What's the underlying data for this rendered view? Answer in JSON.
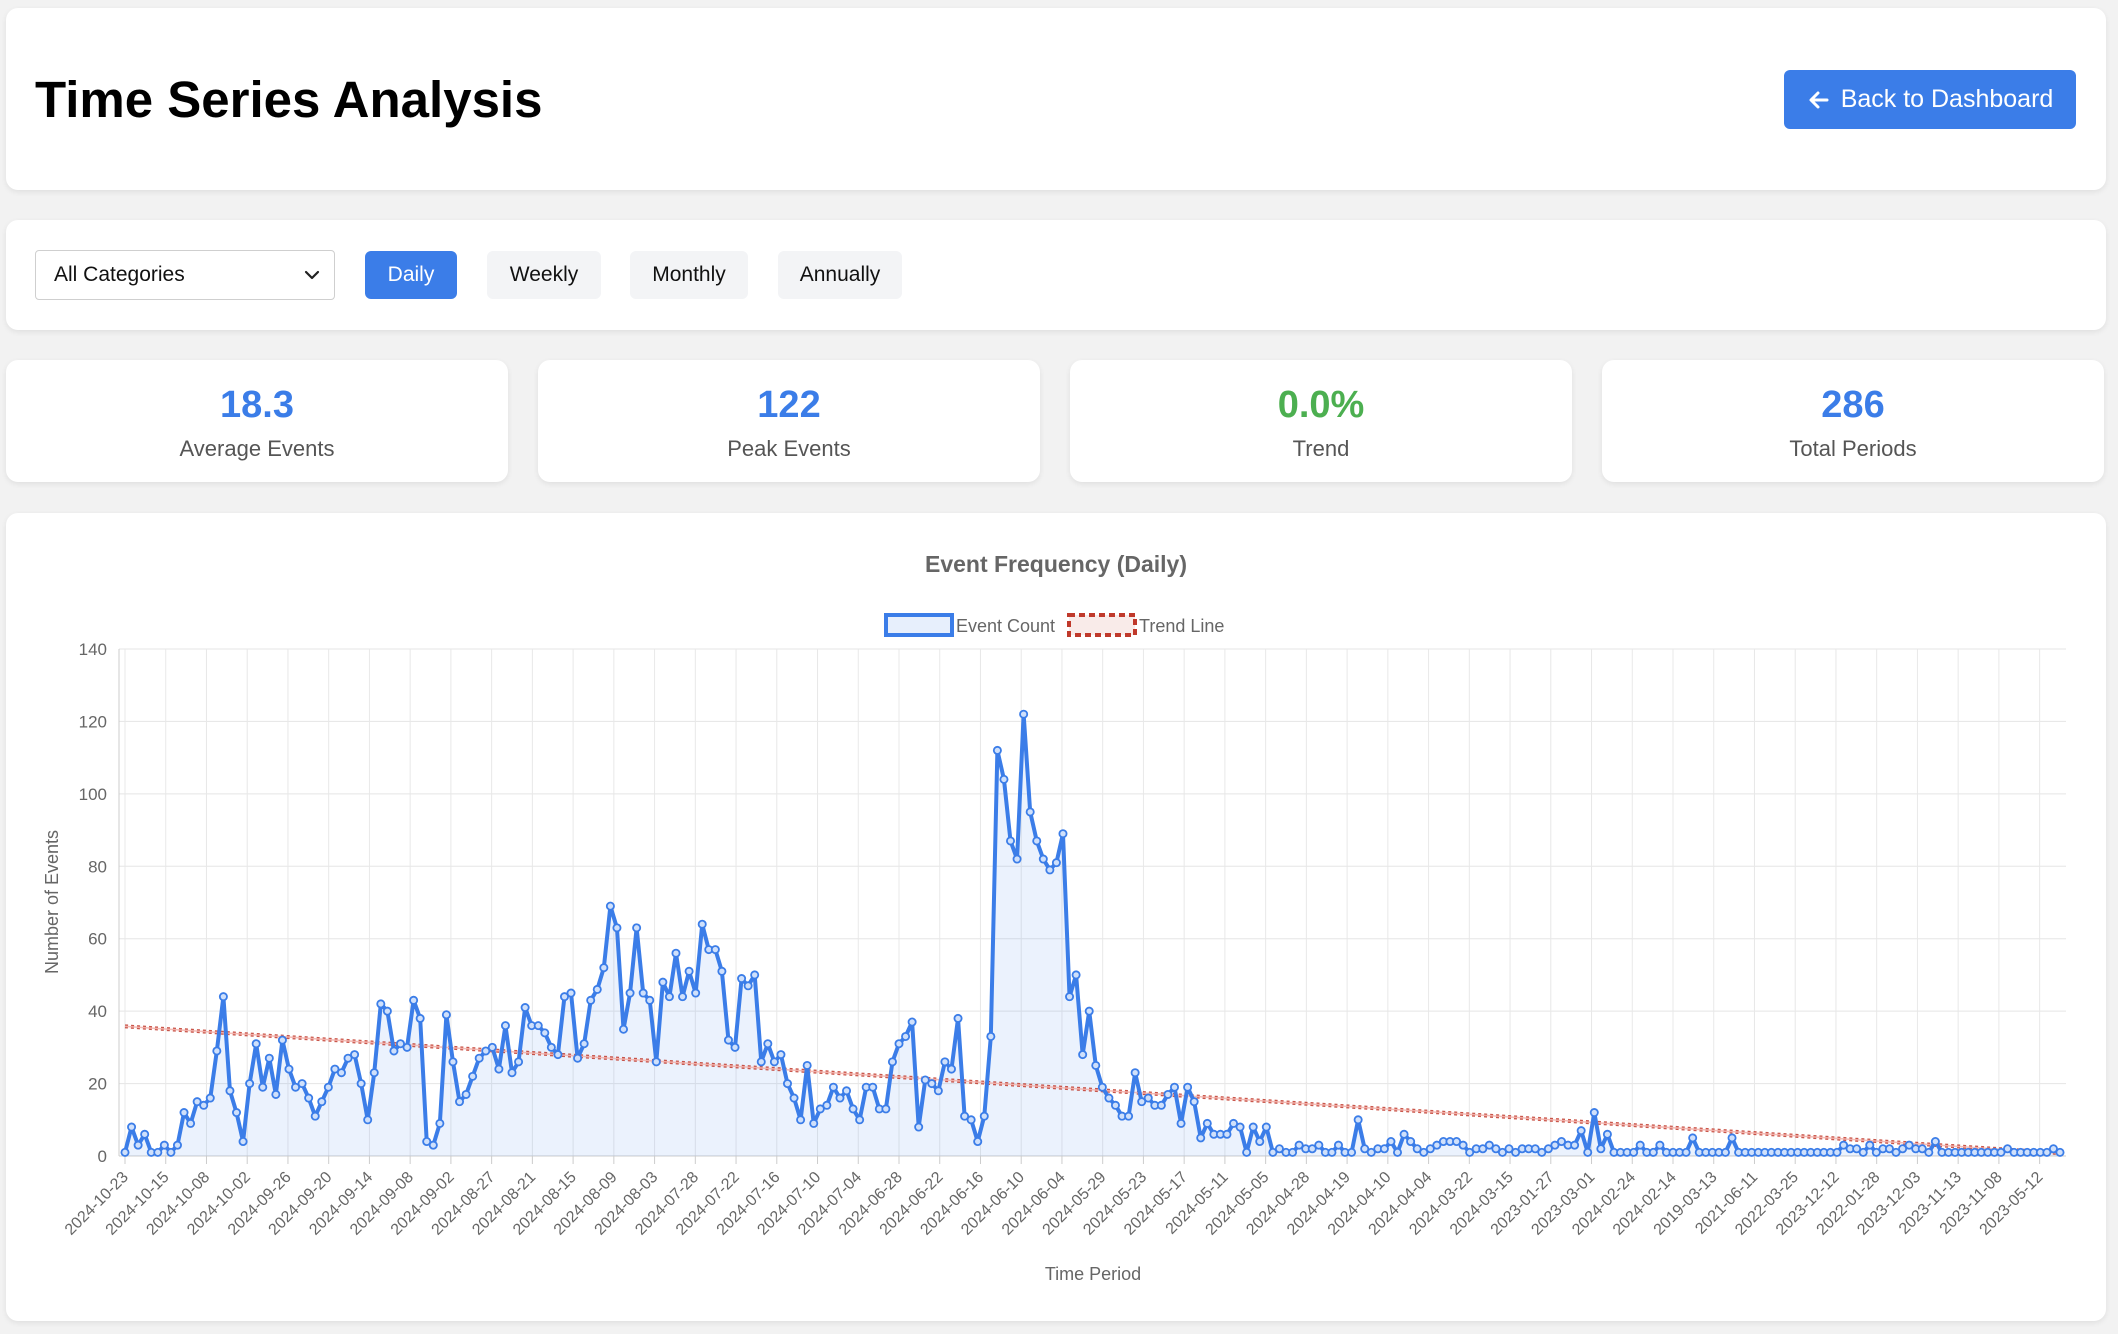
{
  "header": {
    "title": "Time Series Analysis",
    "back_label": "Back to Dashboard"
  },
  "controls": {
    "category": "All Categories",
    "periods": [
      {
        "label": "Daily",
        "active": true
      },
      {
        "label": "Weekly",
        "active": false
      },
      {
        "label": "Monthly",
        "active": false
      },
      {
        "label": "Annually",
        "active": false
      }
    ]
  },
  "stats": [
    {
      "value": "18.3",
      "label": "Average Events",
      "color": "#3b7de8"
    },
    {
      "value": "122",
      "label": "Peak Events",
      "color": "#3b7de8"
    },
    {
      "value": "0.0%",
      "label": "Trend",
      "color": "#4caf50"
    },
    {
      "value": "286",
      "label": "Total Periods",
      "color": "#3b7de8"
    }
  ],
  "colors": {
    "accent": "#3b7de8",
    "trend": "#c0392b",
    "positive": "#4caf50"
  },
  "chart_data": {
    "type": "line",
    "title": "Event Frequency (Daily)",
    "xlabel": "Time Period",
    "ylabel": "Number of Events",
    "ylim": [
      0,
      140
    ],
    "yticks": [
      0,
      20,
      40,
      60,
      80,
      100,
      120,
      140
    ],
    "grid": true,
    "legend_position": "top-center",
    "x_tick_labels": [
      "2024-10-23",
      "2024-10-15",
      "2024-10-08",
      "2024-10-02",
      "2024-09-26",
      "2024-09-20",
      "2024-09-14",
      "2024-09-08",
      "2024-09-02",
      "2024-08-27",
      "2024-08-21",
      "2024-08-15",
      "2024-08-09",
      "2024-08-03",
      "2024-07-28",
      "2024-07-22",
      "2024-07-16",
      "2024-07-10",
      "2024-07-04",
      "2024-06-28",
      "2024-06-22",
      "2024-06-16",
      "2024-06-10",
      "2024-06-04",
      "2024-05-29",
      "2024-05-23",
      "2024-05-17",
      "2024-05-11",
      "2024-05-05",
      "2024-04-28",
      "2024-04-19",
      "2024-04-10",
      "2024-04-04",
      "2024-03-22",
      "2024-03-15",
      "2023-01-27",
      "2023-03-01",
      "2024-02-24",
      "2024-02-14",
      "2019-03-13",
      "2021-06-11",
      "2022-03-25",
      "2023-12-12",
      "2022-01-28",
      "2023-12-03",
      "2023-11-13",
      "2023-11-08",
      "2023-05-12"
    ],
    "series": [
      {
        "name": "Event Count",
        "color": "#3b7de8",
        "values": [
          1,
          8,
          3,
          6,
          1,
          1,
          3,
          1,
          3,
          12,
          9,
          15,
          14,
          16,
          29,
          44,
          18,
          12,
          4,
          20,
          31,
          19,
          27,
          17,
          32,
          24,
          19,
          20,
          16,
          11,
          15,
          19,
          24,
          23,
          27,
          28,
          20,
          10,
          23,
          42,
          40,
          29,
          31,
          30,
          43,
          38,
          4,
          3,
          9,
          39,
          26,
          15,
          17,
          22,
          27,
          29,
          30,
          24,
          36,
          23,
          26,
          41,
          36,
          36,
          34,
          30,
          28,
          44,
          45,
          27,
          31,
          43,
          46,
          52,
          69,
          63,
          35,
          45,
          63,
          45,
          43,
          26,
          48,
          44,
          56,
          44,
          51,
          45,
          64,
          57,
          57,
          51,
          32,
          30,
          49,
          47,
          50,
          26,
          31,
          26,
          28,
          20,
          16,
          10,
          25,
          9,
          13,
          14,
          19,
          16,
          18,
          13,
          10,
          19,
          19,
          13,
          13,
          26,
          31,
          33,
          37,
          8,
          21,
          20,
          18,
          26,
          24,
          38,
          11,
          10,
          4,
          11,
          33,
          112,
          104,
          87,
          82,
          122,
          95,
          87,
          82,
          79,
          81,
          89,
          44,
          50,
          28,
          40,
          25,
          19,
          16,
          14,
          11,
          11,
          23,
          15,
          16,
          14,
          14,
          17,
          19,
          9,
          19,
          15,
          5,
          9,
          6,
          6,
          6,
          9,
          8,
          1,
          8,
          4,
          8,
          1,
          2,
          1,
          1,
          3,
          2,
          2,
          3,
          1,
          1,
          3,
          1,
          1,
          10,
          2,
          1,
          2,
          2,
          4,
          1,
          6,
          4,
          2,
          1,
          2,
          3,
          4,
          4,
          4,
          3,
          1,
          2,
          2,
          3,
          2,
          1,
          2,
          1,
          2,
          2,
          2,
          1,
          2,
          3,
          4,
          3,
          3,
          7,
          1,
          12,
          2,
          6,
          1,
          1,
          1,
          1,
          3,
          1,
          1,
          3,
          1,
          1,
          1,
          1,
          5,
          1,
          1,
          1,
          1,
          1,
          5,
          1,
          1,
          1,
          1,
          1,
          1,
          1,
          1,
          1,
          1,
          1,
          1,
          1,
          1,
          1,
          1,
          3,
          2,
          2,
          1,
          3,
          1,
          2,
          2,
          1,
          2,
          3,
          2,
          2,
          1,
          4,
          1,
          1,
          1,
          1,
          1,
          1,
          1,
          1,
          1,
          1,
          2,
          1,
          1,
          1,
          1,
          1,
          1,
          2,
          1
        ]
      },
      {
        "name": "Trend Line",
        "color": "#c0392b",
        "linear": [
          35.8,
          0.8
        ]
      }
    ]
  }
}
